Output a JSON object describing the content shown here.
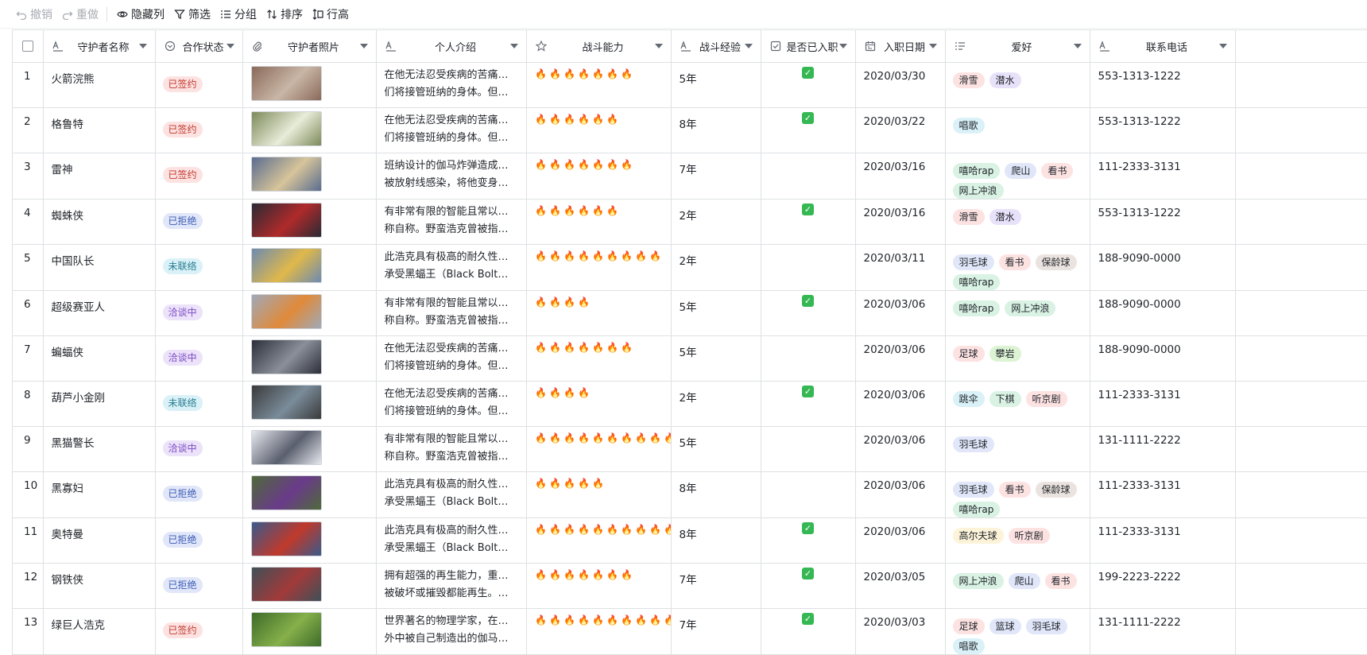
{
  "toolbar": {
    "undo": "撤销",
    "redo": "重做",
    "hide_columns": "隐藏列",
    "filter": "筛选",
    "group": "分组",
    "sort": "排序",
    "row_height": "行高"
  },
  "columns": {
    "name": "守护者名称",
    "status": "合作状态",
    "photo": "守护者照片",
    "intro": "个人介绍",
    "rating": "战斗能力",
    "experience": "战斗经验",
    "onboarded": "是否已入职",
    "date": "入职日期",
    "hobbies": "爱好",
    "phone": "联系电话"
  },
  "rows": [
    {
      "num": "1",
      "name": "火箭浣熊",
      "status": "已签约",
      "intro1": "在他无法忍受疾病的苦痛时，他",
      "intro2": "们将接管班纳的身体。但雷克...",
      "rating": 7,
      "exp": "5年",
      "done": true,
      "date": "2020/03/30",
      "hobbies": [
        "滑雪",
        "潜水"
      ],
      "phone": "553-1313-1222"
    },
    {
      "num": "2",
      "name": "格鲁特",
      "status": "已签约",
      "intro1": "在他无法忍受疾病的苦痛时，他",
      "intro2": "们将接管班纳的身体。但雷克...",
      "rating": 6,
      "exp": "8年",
      "done": true,
      "date": "2020/03/22",
      "hobbies": [
        "唱歌"
      ],
      "phone": "553-1313-1222"
    },
    {
      "num": "3",
      "name": "雷神",
      "status": "已签约",
      "intro1": "班纳设计的伽马炸弹造成了自己",
      "intro2": "被放射线感染，将他变身成为...",
      "rating": 7,
      "exp": "7年",
      "done": false,
      "date": "2020/03/16",
      "hobbies": [
        "嘻哈rap",
        "爬山",
        "看书",
        "网上冲浪"
      ],
      "phone": "111-2333-3131"
    },
    {
      "num": "4",
      "name": "蜘蛛侠",
      "status": "已拒绝",
      "intro1": "有非常有限的智能且常以第三人",
      "intro2": "称自称。野蛮浩克曾被指涉为...",
      "rating": 6,
      "exp": "2年",
      "done": true,
      "date": "2020/03/16",
      "hobbies": [
        "滑雪",
        "潜水"
      ],
      "phone": "553-1313-1222"
    },
    {
      "num": "5",
      "name": "中国队长",
      "status": "未联络",
      "intro1": "此浩克具有极高的耐久性，可以",
      "intro2": "承受黑蝠王（Black Bolt）的...",
      "rating": 9,
      "exp": "2年",
      "done": false,
      "date": "2020/03/11",
      "hobbies": [
        "羽毛球",
        "看书",
        "保龄球",
        "嘻哈rap"
      ],
      "phone": "188-9090-0000"
    },
    {
      "num": "6",
      "name": "超级赛亚人",
      "status": "洽谈中",
      "intro1": "有非常有限的智能且常以第三人",
      "intro2": "称自称。野蛮浩克曾被指涉为...",
      "rating": 4,
      "exp": "5年",
      "done": true,
      "date": "2020/03/06",
      "hobbies": [
        "嘻哈rap",
        "网上冲浪"
      ],
      "phone": "188-9090-0000"
    },
    {
      "num": "7",
      "name": "蝙蝠侠",
      "status": "洽谈中",
      "intro1": "在他无法忍受疾病的苦痛时，他",
      "intro2": "们将接管班纳的身体。但雷克...",
      "rating": 7,
      "exp": "5年",
      "done": false,
      "date": "2020/03/06",
      "hobbies": [
        "足球",
        "攀岩"
      ],
      "phone": "188-9090-0000"
    },
    {
      "num": "8",
      "name": "葫芦小金刚",
      "status": "未联络",
      "intro1": "在他无法忍受疾病的苦痛时，他",
      "intro2": "们将接管班纳的身体。但雷克...",
      "rating": 4,
      "exp": "2年",
      "done": true,
      "date": "2020/03/06",
      "hobbies": [
        "跳伞",
        "下棋",
        "听京剧"
      ],
      "phone": "111-2333-3131"
    },
    {
      "num": "9",
      "name": "黑猫警长",
      "status": "洽谈中",
      "intro1": "有非常有限的智能且常以第三人",
      "intro2": "称自称。野蛮浩克曾被指涉为...",
      "rating": 10,
      "exp": "5年",
      "done": false,
      "date": "2020/03/06",
      "hobbies": [
        "羽毛球"
      ],
      "phone": "131-1111-2222"
    },
    {
      "num": "10",
      "name": "黑寡妇",
      "status": "已拒绝",
      "intro1": "此浩克具有极高的耐久性，可以",
      "intro2": "承受黑蝠王（Black Bolt）的...",
      "rating": 5,
      "exp": "8年",
      "done": false,
      "date": "2020/03/06",
      "hobbies": [
        "羽毛球",
        "看书",
        "保龄球",
        "嘻哈rap"
      ],
      "phone": "111-2333-3131"
    },
    {
      "num": "11",
      "name": "奥特曼",
      "status": "已拒绝",
      "intro1": "此浩克具有极高的耐久性，可以",
      "intro2": "承受黑蝠王（Black Bolt）的...",
      "rating": 10,
      "exp": "8年",
      "done": true,
      "date": "2020/03/06",
      "hobbies": [
        "高尔夫球",
        "听京剧"
      ],
      "phone": "111-2333-3131"
    },
    {
      "num": "12",
      "name": "钢铁侠",
      "status": "已拒绝",
      "intro1": "拥有超强的再生能力，重要器官",
      "intro2": "被破坏或摧毁都能再生。他也...",
      "rating": 7,
      "exp": "7年",
      "done": true,
      "date": "2020/03/05",
      "hobbies": [
        "网上冲浪",
        "爬山",
        "看书"
      ],
      "phone": "199-2223-2222"
    },
    {
      "num": "13",
      "name": "绿巨人浩克",
      "status": "已签约",
      "intro1": "世界著名的物理学家，在一次意",
      "intro2": "外中被自己制造出的伽马炸弹...",
      "rating": 10,
      "exp": "7年",
      "done": true,
      "date": "2020/03/03",
      "hobbies": [
        "足球",
        "篮球",
        "羽毛球",
        "唱歌"
      ],
      "phone": "131-1111-2222"
    }
  ],
  "status_colors": {
    "已签约": {
      "bg": "#fde2e2",
      "fg": "#c0392b"
    },
    "已拒绝": {
      "bg": "#e1e7f9",
      "fg": "#3b5bb5"
    },
    "未联络": {
      "bg": "#d9f1f7",
      "fg": "#2b7f94"
    },
    "洽谈中": {
      "bg": "#ece2fa",
      "fg": "#7b4bc4"
    }
  },
  "tag_colors": {
    "滑雪": "#fde2e2",
    "潜水": "#e7e2fa",
    "唱歌": "#d9f1f7",
    "嘻哈rap": "#d9f2e4",
    "爬山": "#e1e7f9",
    "看书": "#fde2e2",
    "网上冲浪": "#d9f2e4",
    "羽毛球": "#e1e7f9",
    "保龄球": "#ebe3df",
    "足球": "#fde2e2",
    "攀岩": "#dcf3d4",
    "跳伞": "#d9f1f7",
    "下棋": "#d9f2e4",
    "听京剧": "#fde2e2",
    "高尔夫球": "#fcf3d9",
    "篮球": "#e1e7f9"
  },
  "rating_icon": "fire-icon",
  "done_color": "#35b853"
}
